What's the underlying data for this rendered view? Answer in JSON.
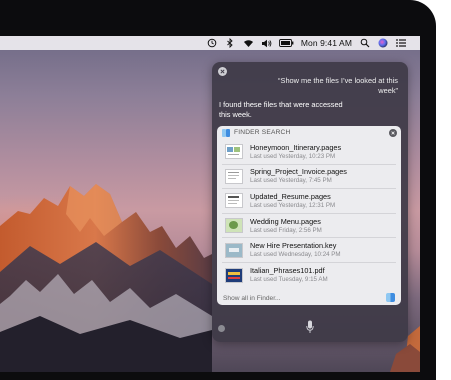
{
  "menubar": {
    "clock": "Mon 9:41 AM",
    "icons": [
      "time-machine-icon",
      "bluetooth-icon",
      "wifi-icon",
      "volume-icon",
      "battery-icon",
      "spotlight-icon",
      "siri-icon",
      "notification-center-icon"
    ]
  },
  "siri": {
    "query": "“Show me the files I’ve looked at this week”",
    "answer": "I found these files that were accessed this week.",
    "finder": {
      "header": "FINDER SEARCH",
      "files": [
        {
          "name": "Honeymoon_Itinerary.pages",
          "used": "Last used Yesterday, 10:23 PM"
        },
        {
          "name": "Spring_Project_Invoice.pages",
          "used": "Last used Yesterday, 7:45 PM"
        },
        {
          "name": "Updated_Resume.pages",
          "used": "Last used Yesterday, 12:31 PM"
        },
        {
          "name": "Wedding Menu.pages",
          "used": "Last used Friday, 2:56 PM"
        },
        {
          "name": "New Hire Presentation.key",
          "used": "Last used Wednesday, 10:24 PM"
        },
        {
          "name": "Italian_Phrases101.pdf",
          "used": "Last used Tuesday, 9:15 AM"
        }
      ],
      "show_all": "Show all in Finder..."
    }
  },
  "colors": {
    "panel_bg": "#3e3a46",
    "finder_bg": "#ececef",
    "menubar_bg": "#eeecf0"
  }
}
